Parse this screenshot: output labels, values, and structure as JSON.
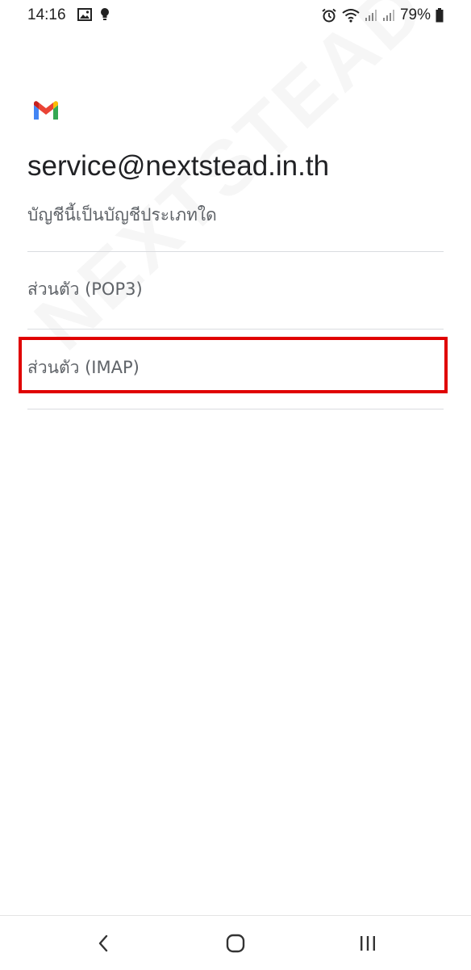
{
  "status_bar": {
    "time": "14:16",
    "battery_percent": "79%",
    "left_icons": [
      "image-icon",
      "bulb-icon"
    ],
    "right_icons": [
      "alarm-icon",
      "wifi-icon",
      "signal-icon",
      "signal-icon",
      "battery-icon"
    ]
  },
  "watermark": "NEXTSTEAD",
  "app": {
    "logo": "gmail-icon",
    "account_email": "service@nextstead.in.th",
    "question": "บัญชีนี้เป็นบัญชีประเภทใด"
  },
  "options": [
    {
      "label": "ส่วนตัว (POP3)"
    },
    {
      "label": "ส่วนตัว (IMAP)",
      "highlighted": true
    }
  ],
  "nav_bar": {
    "buttons": [
      "back-icon",
      "home-icon",
      "recents-icon"
    ]
  },
  "colors": {
    "highlight": "#e00000",
    "text_primary": "#202124",
    "text_secondary": "#5f6368",
    "divider": "#dadce0"
  }
}
